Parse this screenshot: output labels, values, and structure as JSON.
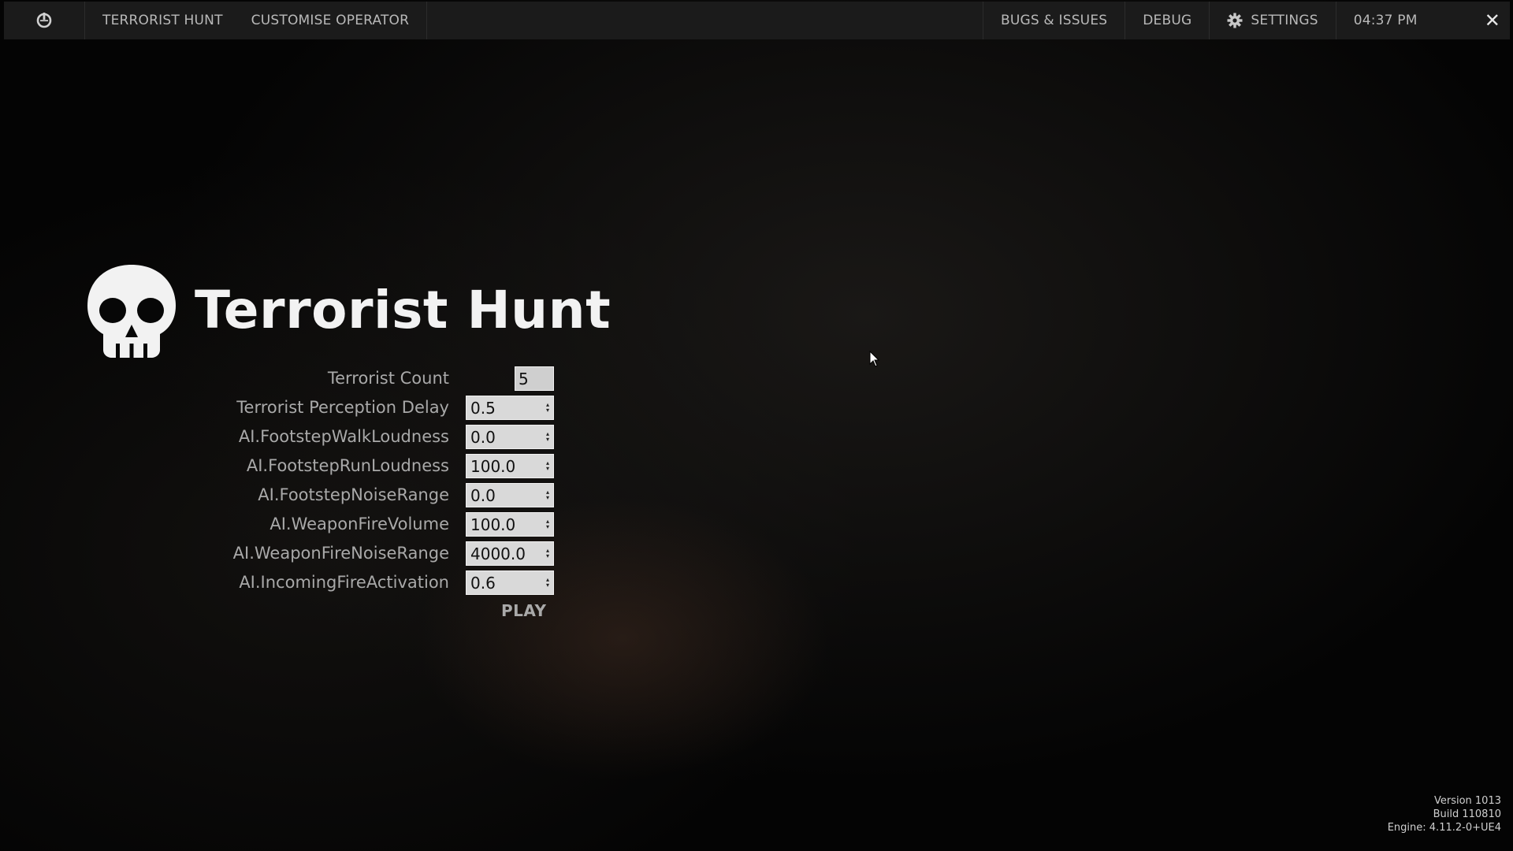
{
  "topbar": {
    "logo_icon": "power-logo-icon",
    "nav": [
      "TERRORIST HUNT",
      "CUSTOMISE OPERATOR"
    ],
    "bugs": "BUGS & ISSUES",
    "debug": "DEBUG",
    "settings": "SETTINGS",
    "settings_icon": "gear-icon",
    "time": "04:37 PM",
    "close_icon": "close-icon",
    "close_glyph": "✕"
  },
  "page": {
    "title": "Terrorist Hunt",
    "title_icon": "skull-icon"
  },
  "form": {
    "fields": [
      {
        "label": "Terrorist Count",
        "value": "5"
      },
      {
        "label": "Terrorist Perception Delay",
        "value": "0.5"
      },
      {
        "label": "AI.FootstepWalkLoudness",
        "value": "0.0"
      },
      {
        "label": "AI.FootstepRunLoudness",
        "value": "100.0"
      },
      {
        "label": "AI.FootstepNoiseRange",
        "value": "0.0"
      },
      {
        "label": "AI.WeaponFireVolume",
        "value": "100.0"
      },
      {
        "label": "AI.WeaponFireNoiseRange",
        "value": "4000.0"
      },
      {
        "label": "AI.IncomingFireActivation",
        "value": "0.6"
      }
    ],
    "play": "PLAY"
  },
  "version_info": {
    "version": "Version 1013",
    "build": "Build 110810",
    "engine": "Engine: 4.11.2-0+UE4"
  },
  "colors": {
    "background": "#050505",
    "topbar": "#1b1b1b",
    "label_text": "#a9a9a9",
    "title_text": "#f2f2f2"
  }
}
